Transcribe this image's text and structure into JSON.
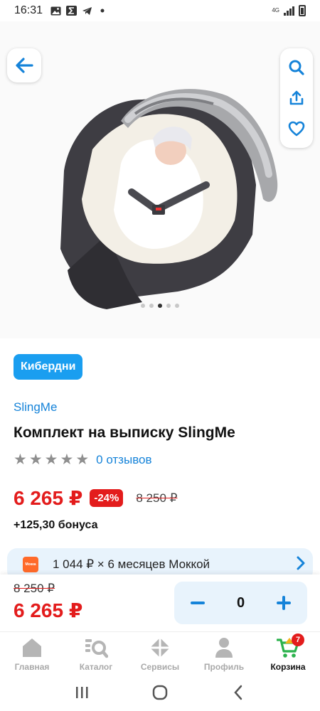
{
  "status_bar": {
    "time": "16:31",
    "network": "4G",
    "icons": [
      "image-icon",
      "sigma-icon",
      "telegram-icon",
      "dot-icon"
    ]
  },
  "toolbar": {
    "back_icon": "arrow-left-icon",
    "search_icon": "search-icon",
    "share_icon": "share-icon",
    "favorite_icon": "heart-icon"
  },
  "gallery": {
    "image_description_icon": "product-photo",
    "dots_total": 5,
    "dots_active_index": 2
  },
  "product": {
    "badge": "Кибердни",
    "brand": "SlingMe",
    "title": "Комплект на выписку SlingMe",
    "rating_stars": 0,
    "rating_max": 5,
    "reviews": "0 отзывов",
    "price": "6 265 ₽",
    "discount": "-24%",
    "old_price": "8 250 ₽",
    "bonus": "+125,30 бонуса"
  },
  "installment": {
    "logo_text": "Мокка",
    "text": "1 044 ₽ × 6 месяцев Моккой"
  },
  "buy_bar": {
    "old_price": "8 250 ₽",
    "price": "6 265 ₽",
    "quantity": "0"
  },
  "bottom_nav": {
    "items": [
      {
        "label": "Главная",
        "icon": "home-icon"
      },
      {
        "label": "Каталог",
        "icon": "catalog-search-icon"
      },
      {
        "label": "Сервисы",
        "icon": "services-icon"
      },
      {
        "label": "Профиль",
        "icon": "profile-icon"
      },
      {
        "label": "Корзина",
        "icon": "cart-icon"
      }
    ],
    "cart_count": "7",
    "active_index": 4
  },
  "colors": {
    "accent_blue": "#1a9ef0",
    "link_blue": "#1583d9",
    "price_red": "#e31c1c",
    "light_blue_bg": "#e8f3fc",
    "cart_green": "#2bb24c"
  }
}
